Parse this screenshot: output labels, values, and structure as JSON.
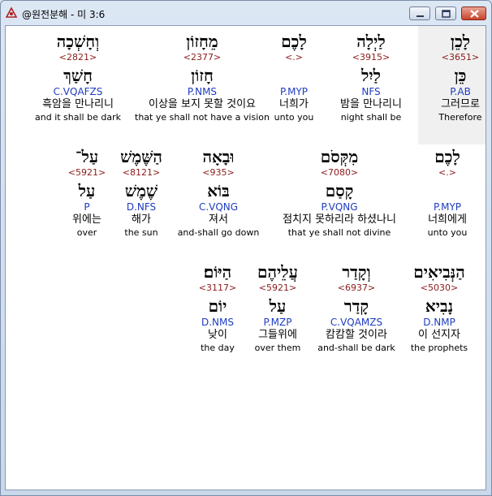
{
  "window": {
    "title": "@원전분해 - 미 3:6"
  },
  "rows": [
    [
      {
        "hebrew": "לָכֵן",
        "strong": "<3651>",
        "lemma": "כֵּן",
        "parse": "P.AB",
        "korean": "그러므로",
        "english": "Therefore",
        "selected": true
      },
      {
        "hebrew": "לַיְלָה",
        "strong": "<3915>",
        "lemma": "לַיִל",
        "parse": "NFS",
        "korean": "밤을 만나리니",
        "english": "night shall be"
      },
      {
        "hebrew": "לָכֶם",
        "strong": "<.>",
        "lemma": "",
        "parse": "P.MYP",
        "korean": "너희가",
        "english": "unto you"
      },
      {
        "hebrew": "מֵחָזוֹן",
        "strong": "<2377>",
        "lemma": "חָזוֹן",
        "parse": "P.NMS",
        "korean": "이상을 보지 못할 것이요",
        "english": "that ye shall not have a vision"
      },
      {
        "hebrew": "וְחָשְׁכָה",
        "strong": "<2821>",
        "lemma": "חָשַׁךְ",
        "parse": "C.VQAFZS",
        "korean": "흑암을 만나리니",
        "english": "and it shall be dark"
      }
    ],
    [
      {
        "hebrew": "לָכֶם",
        "strong": "<.>",
        "lemma": "",
        "parse": "P.MYP",
        "korean": "너희에게",
        "english": "unto you"
      },
      {
        "hebrew": "מִקְּסֹם",
        "strong": "<7080>",
        "lemma": "קָסַם",
        "parse": "P.VQNG",
        "korean": "점치지 못하리라 하셨나니",
        "english": "that ye shall not divine"
      },
      {
        "hebrew": "וּבָאָה",
        "strong": "<935>",
        "lemma": "בּוֹא",
        "parse": "C.VQNG",
        "korean": "져서",
        "english": "and-shall go down"
      },
      {
        "hebrew": "הַשֶּׁמֶשׁ",
        "strong": "<8121>",
        "lemma": "שֶׁמֶשׁ",
        "parse": "D.NFS",
        "korean": "해가",
        "english": "the sun"
      },
      {
        "hebrew": "עַל־",
        "strong": "<5921>",
        "lemma": "עַל",
        "parse": "P",
        "korean": "위에는",
        "english": "over"
      }
    ],
    [
      {
        "hebrew": "הַנְּבִיאִים",
        "strong": "<5030>",
        "lemma": "נָבִיא",
        "parse": "D.NMP",
        "korean": "이 선지자",
        "english": "the prophets"
      },
      {
        "hebrew": "וְקָדַר",
        "strong": "<6937>",
        "lemma": "קָדַר",
        "parse": "C.VQAMZS",
        "korean": "캄캄할 것이라",
        "english": "and-shall be dark"
      },
      {
        "hebrew": "עֲלֵיהֶם",
        "strong": "<5921>",
        "lemma": "עַל",
        "parse": "P.MZP",
        "korean": "그들위에",
        "english": "over them"
      },
      {
        "hebrew": "הַיּוֹם׃",
        "strong": "<3117>",
        "lemma": "יוֹם",
        "parse": "D.NMS",
        "korean": "낮이",
        "english": "the day"
      }
    ]
  ]
}
